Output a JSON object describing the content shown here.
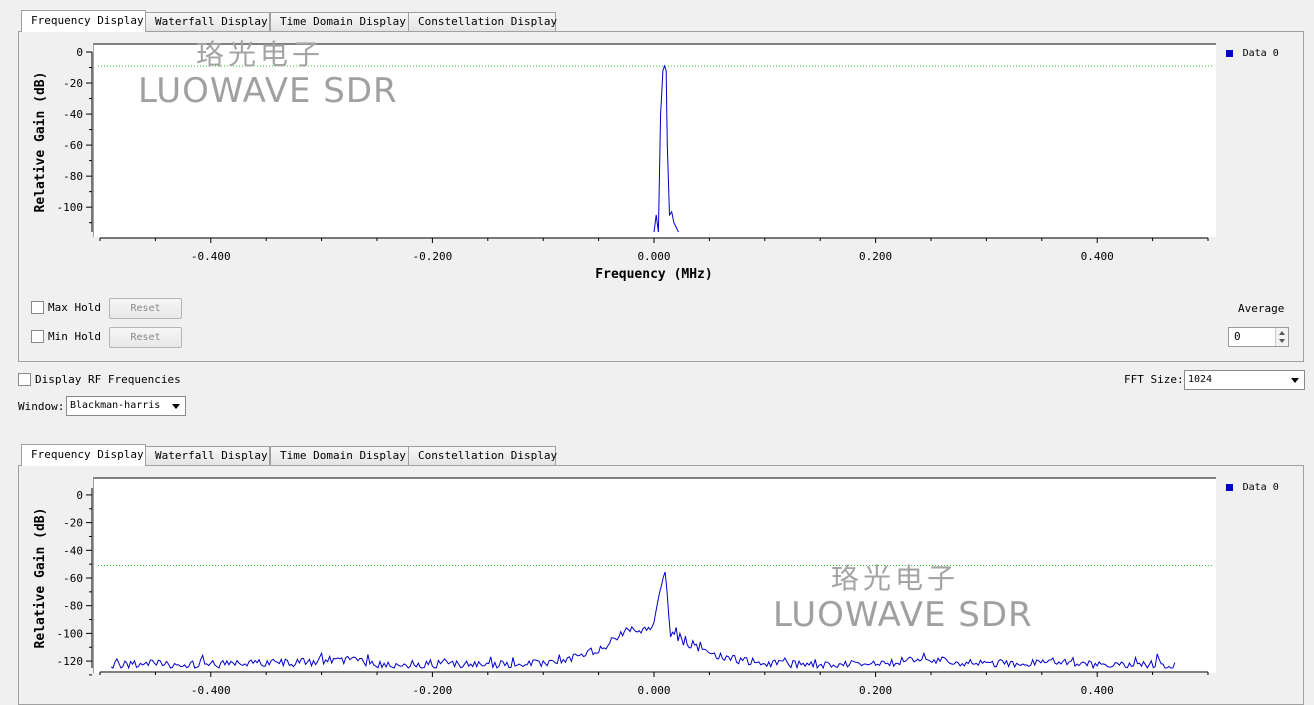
{
  "tabs": [
    "Frequency Display",
    "Waterfall Display",
    "Time Domain Display",
    "Constellation Display"
  ],
  "top_plot": {
    "ylabel": "Relative Gain (dB)",
    "xlabel": "Frequency (MHz)",
    "legend": "Data 0",
    "y_ticks": [
      "0",
      "-20",
      "-40",
      "-60",
      "-80",
      "-100"
    ],
    "x_ticks": [
      "-0.400",
      "-0.200",
      "0.000",
      "0.200",
      "0.400"
    ],
    "threshold_db": -9,
    "line_color": "#0000cc",
    "threshold_color": "#22cc22"
  },
  "bottom_plot": {
    "ylabel": "Relative Gain (dB)",
    "legend": "Data 0",
    "y_ticks": [
      "0",
      "-20",
      "-40",
      "-60",
      "-80",
      "-100",
      "-120"
    ],
    "x_ticks": [
      "-0.400",
      "-0.200",
      "0.000",
      "0.200",
      "0.400"
    ],
    "threshold_db": -51,
    "line_color": "#0000cc",
    "threshold_color": "#22cc22"
  },
  "controls": {
    "max_hold": "Max Hold",
    "min_hold": "Min Hold",
    "reset": "Reset",
    "average_label": "Average",
    "average_value": "0",
    "display_rf": "Display RF Frequencies",
    "fft_label": "FFT Size:",
    "fft_value": "1024",
    "window_label": "Window:",
    "window_value": "Blackman-harris"
  },
  "watermark": {
    "cn": "珞光电子",
    "en": "LUOWAVE SDR"
  },
  "chart_data": [
    {
      "type": "line",
      "xlabel": "Frequency (MHz)",
      "ylabel": "Relative Gain (dB)",
      "xlim": [
        -0.5,
        0.5
      ],
      "ylim": [
        -116,
        0
      ],
      "grid": false,
      "legend": "top-right",
      "series": [
        {
          "name": "Data 0",
          "x": [
            0.0,
            0.002,
            0.004,
            0.006,
            0.008,
            0.0095,
            0.011,
            0.012,
            0.014,
            0.016,
            0.018,
            0.02,
            0.022
          ],
          "y": [
            -116,
            -105,
            -116,
            -40,
            -12,
            -9,
            -12,
            -60,
            -105,
            -103,
            -110,
            -113,
            -116
          ]
        }
      ],
      "threshold_db": -9
    },
    {
      "type": "line",
      "xlabel": "",
      "ylabel": "Relative Gain (dB)",
      "xlim": [
        -0.5,
        0.5
      ],
      "ylim": [
        -125,
        5
      ],
      "grid": false,
      "legend": "top-right",
      "series": [
        {
          "name": "Data 0",
          "x": [
            -0.49,
            -0.46,
            -0.42,
            -0.36,
            -0.32,
            -0.28,
            -0.24,
            -0.2,
            -0.16,
            -0.12,
            -0.1,
            -0.08,
            -0.06,
            -0.05,
            -0.04,
            -0.03,
            -0.02,
            -0.01,
            0.0,
            0.005,
            0.01,
            0.015,
            0.02,
            0.03,
            0.04,
            0.06,
            0.08,
            0.12,
            0.16,
            0.2,
            0.24,
            0.28,
            0.32,
            0.36,
            0.4,
            0.44,
            0.47
          ],
          "y": [
            -120,
            -119,
            -120,
            -119,
            -118,
            -116,
            -120,
            -119,
            -120,
            -119,
            -118,
            -115,
            -112,
            -108,
            -104,
            -97,
            -95,
            -94,
            -92,
            -70,
            -51,
            -98,
            -100,
            -105,
            -108,
            -113,
            -117,
            -119,
            -120,
            -119,
            -116,
            -118,
            -119,
            -117,
            -120,
            -119,
            -121
          ]
        }
      ],
      "threshold_db": -51
    }
  ]
}
